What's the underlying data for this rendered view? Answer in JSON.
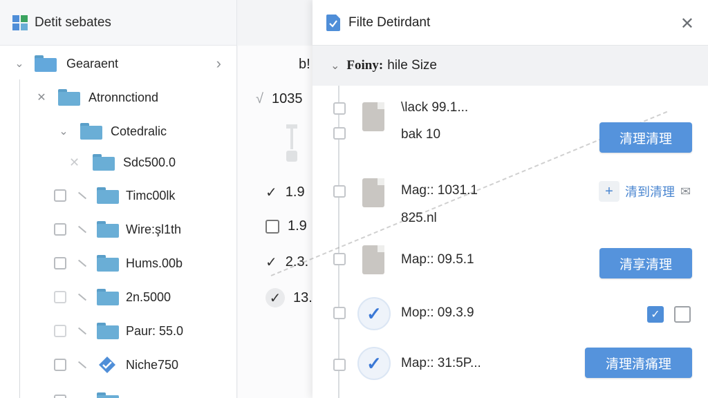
{
  "left": {
    "title": "Detit sebates",
    "tree": [
      {
        "label": "Gearaent"
      },
      {
        "label": "Atronnctiond"
      },
      {
        "label": "Cotedralic"
      },
      {
        "label": "Sdc500.0"
      },
      {
        "label": "Timc00lk"
      },
      {
        "label": "Wire:şl1th"
      },
      {
        "label": "Hums.00b"
      },
      {
        "label": "2n.5000"
      },
      {
        "label": "Paur: 55.0"
      },
      {
        "label": "Niche750"
      }
    ]
  },
  "mid": {
    "rows": [
      {
        "value": "b!"
      },
      {
        "value": "1035"
      },
      {
        "value": "1.9"
      },
      {
        "value": "1.9"
      },
      {
        "value": "2.3."
      },
      {
        "value": "13."
      }
    ]
  },
  "dialog": {
    "title": "Filte Detirdant",
    "section": {
      "bold": "Foiny:",
      "rest": "hile Size"
    },
    "files": [
      {
        "name": "\\lack 99.1...",
        "sub": "bak 10",
        "action": "清理清理"
      },
      {
        "name": "Mag:: 1031.1",
        "sub": "825.nl",
        "action": "清到清理"
      },
      {
        "name": "Map:: 09.5.1",
        "sub": "",
        "action": "清享清理"
      },
      {
        "name": "Mop:: 09.3.9",
        "sub": "",
        "action": ""
      },
      {
        "name": "Map:: 31:5P...",
        "sub": "",
        "action": "清理清痛理"
      }
    ]
  },
  "colors": {
    "accent": "#5593dc",
    "folder": "#6aaed6"
  }
}
